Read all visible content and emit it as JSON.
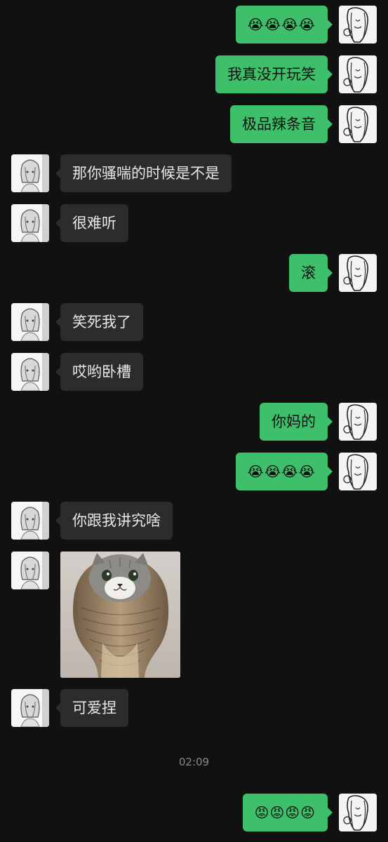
{
  "messages": [
    {
      "side": "me",
      "text": "😭😭😭😭"
    },
    {
      "side": "me",
      "text": "我真没开玩笑"
    },
    {
      "side": "me",
      "text": "极品辣条音"
    },
    {
      "side": "them",
      "text": "那你骚喘的时候是不是"
    },
    {
      "side": "them",
      "text": "很难听"
    },
    {
      "side": "me",
      "text": "滚"
    },
    {
      "side": "them",
      "text": "笑死我了"
    },
    {
      "side": "them",
      "text": "哎哟卧槽"
    },
    {
      "side": "me",
      "text": "你妈的"
    },
    {
      "side": "me",
      "text": "😭😭😭😭"
    },
    {
      "side": "them",
      "text": "你跟我讲究啥"
    },
    {
      "side": "them",
      "type": "sticker",
      "sticker_name": "cat-cobra-sticker"
    },
    {
      "side": "them",
      "text": "可爱捏"
    },
    {
      "side": "me",
      "text": "😡😡😡😡"
    }
  ],
  "timestamp": "02:09",
  "colors": {
    "background": "#111111",
    "outgoing_bubble": "#3ec06a",
    "incoming_bubble": "#2c2c2c"
  }
}
